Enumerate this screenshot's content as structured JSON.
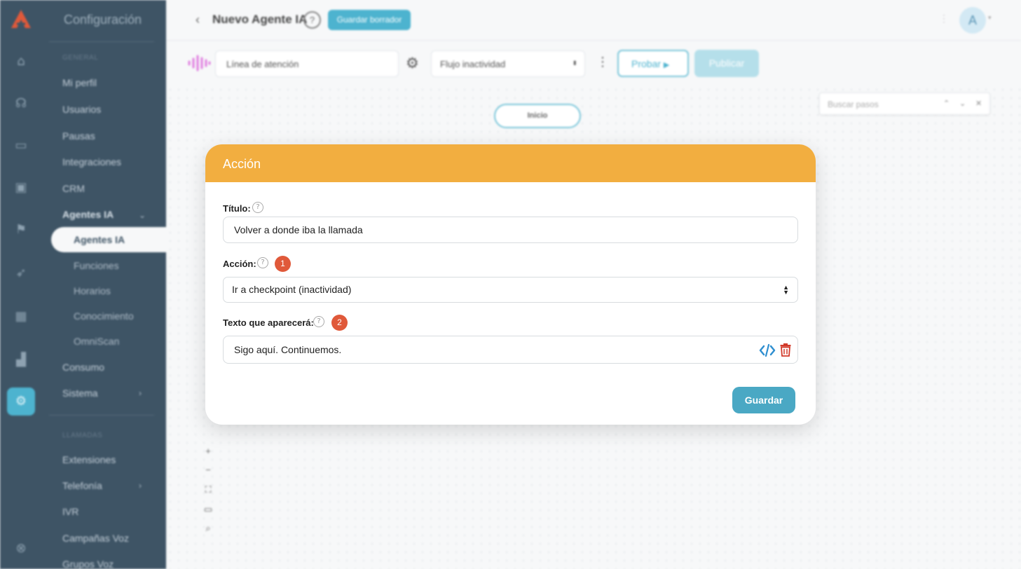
{
  "sidebar": {
    "title": "Configuración",
    "section_general": "GENERAL",
    "section_llamadas": "LLAMADAS",
    "items": {
      "mi_perfil": "Mi perfil",
      "usuarios": "Usuarios",
      "pausas": "Pausas",
      "integraciones": "Integraciones",
      "crm": "CRM",
      "agentes_ia": "Agentes IA",
      "agentes_ia_sub": "Agentes IA",
      "funciones": "Funciones",
      "horarios": "Horarios",
      "conocimiento": "Conocimiento",
      "omniscan": "OmniScan",
      "consumo": "Consumo",
      "sistema": "Sistema",
      "extensiones": "Extensiones",
      "telefonia": "Telefonía",
      "ivr": "IVR",
      "campanas_voz": "Campañas Voz",
      "grupos_voz": "Grupos Voz"
    }
  },
  "header": {
    "title": "Nuevo Agente IA",
    "help": "?",
    "save_draft": "Guardar borrador",
    "avatar_initial": "A"
  },
  "toolbar": {
    "line_value": "Línea de atención",
    "flow_select": "Flujo inactividad",
    "test_label": "Probar",
    "publish_label": "Publicar"
  },
  "canvas": {
    "start_node": "Inicio",
    "search_placeholder": "Buscar pasos"
  },
  "modal": {
    "header": "Acción",
    "title_label": "Título:",
    "title_value": "Volver a donde iba la llamada",
    "action_label": "Acción:",
    "action_badge": "1",
    "action_value": "Ir a checkpoint (inactividad)",
    "text_label": "Texto que aparecerá:",
    "text_badge": "2",
    "text_value": "Sigo aquí. Continuemos.",
    "save_label": "Guardar"
  },
  "colors": {
    "sidebar_bg": "#3e5465",
    "accent": "#4db3cf",
    "modal_header": "#f2ae40",
    "badge": "#e0593a",
    "save_button": "#4aa8c4",
    "trash": "#d23a2a"
  },
  "icons": [
    "logo-icon",
    "home-icon",
    "headset-icon",
    "inbox-icon",
    "contacts-icon",
    "flag-icon",
    "rocket-icon",
    "calendar-icon",
    "chart-icon",
    "settings-icon",
    "support-icon",
    "back-icon",
    "help-icon",
    "wave-icon",
    "gear-icon",
    "kebab-icon",
    "play-icon",
    "zoom-in-icon",
    "zoom-out-icon",
    "fit-icon",
    "minimap-icon",
    "zoom-search-icon",
    "code-icon",
    "trash-icon"
  ]
}
